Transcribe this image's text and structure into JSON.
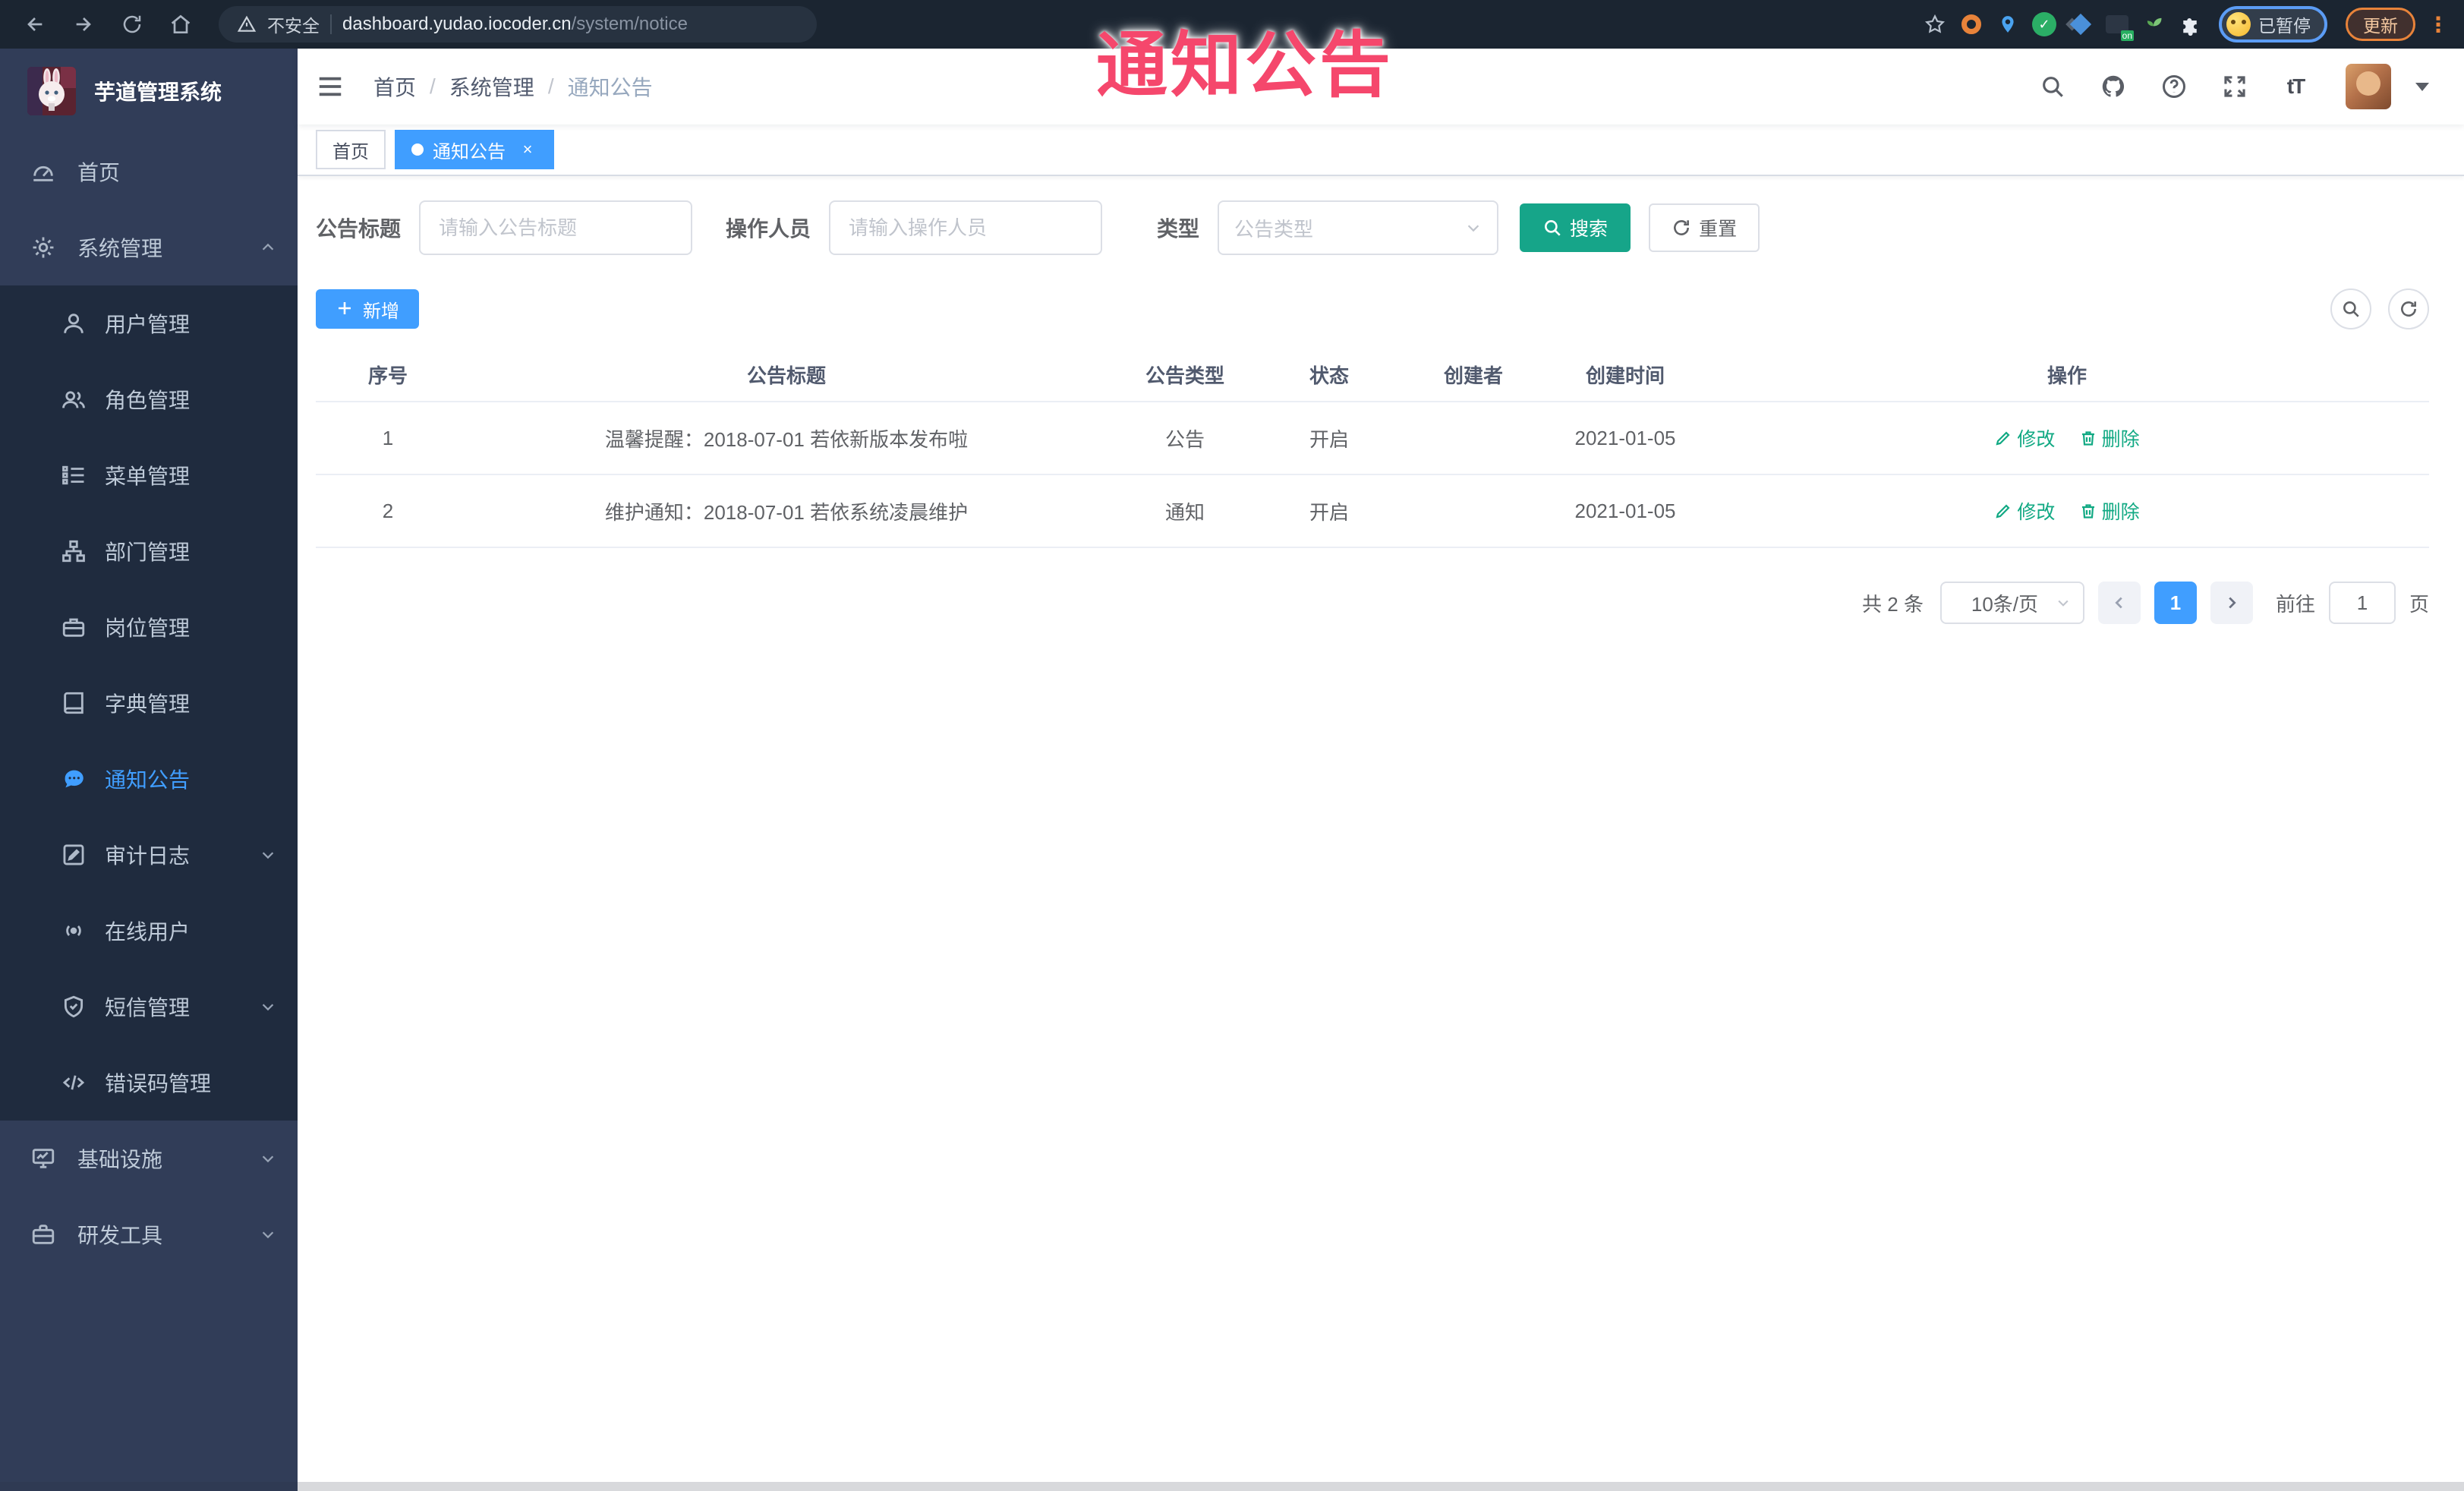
{
  "browser": {
    "security_label": "不安全",
    "url_domain": "dashboard.yudao.iocoder.cn",
    "url_path": "/system/notice",
    "profile_status": "已暂停",
    "update_label": "更新"
  },
  "watermark_text": "通知公告",
  "sidebar": {
    "title": "芋道管理系统",
    "items": [
      {
        "label": "首页",
        "icon": "dashboard-icon"
      },
      {
        "label": "系统管理",
        "icon": "gear-icon",
        "state": "expanded"
      },
      {
        "label": "用户管理",
        "icon": "user-icon"
      },
      {
        "label": "角色管理",
        "icon": "roles-icon"
      },
      {
        "label": "菜单管理",
        "icon": "menu-tree-icon"
      },
      {
        "label": "部门管理",
        "icon": "org-icon"
      },
      {
        "label": "岗位管理",
        "icon": "post-icon"
      },
      {
        "label": "字典管理",
        "icon": "dict-icon"
      },
      {
        "label": "通知公告",
        "icon": "notice-icon",
        "state": "active"
      },
      {
        "label": "审计日志",
        "icon": "audit-log-icon",
        "state": "collapsed"
      },
      {
        "label": "在线用户",
        "icon": "online-user-icon"
      },
      {
        "label": "短信管理",
        "icon": "sms-icon",
        "state": "collapsed"
      },
      {
        "label": "错误码管理",
        "icon": "error-code-icon"
      },
      {
        "label": "基础设施",
        "icon": "infrastructure-icon",
        "state": "collapsed"
      },
      {
        "label": "研发工具",
        "icon": "dev-tools-icon",
        "state": "collapsed"
      }
    ]
  },
  "breadcrumb": [
    "首页",
    "系统管理",
    "通知公告"
  ],
  "tabs": [
    {
      "label": "首页",
      "active": false
    },
    {
      "label": "通知公告",
      "active": true,
      "close": "×"
    }
  ],
  "filters": {
    "title_label": "公告标题",
    "title_placeholder": "请输入公告标题",
    "operator_label": "操作人员",
    "operator_placeholder": "请输入操作人员",
    "type_label": "类型",
    "type_placeholder": "公告类型",
    "search_label": "搜索",
    "reset_label": "重置"
  },
  "toolbar": {
    "add_label": "新增"
  },
  "table": {
    "headers": [
      "序号",
      "公告标题",
      "公告类型",
      "状态",
      "创建者",
      "创建时间",
      "操作"
    ],
    "actions": {
      "edit": "修改",
      "delete": "删除"
    },
    "rows": [
      {
        "num": "1",
        "title": "温馨提醒：2018-07-01 若依新版本发布啦",
        "type": "公告",
        "status": "开启",
        "creator": "",
        "created_at": "2021-01-05"
      },
      {
        "num": "2",
        "title": "维护通知：2018-07-01 若依系统凌晨维护",
        "type": "通知",
        "status": "开启",
        "creator": "",
        "created_at": "2021-01-05"
      }
    ]
  },
  "pagination": {
    "total": "共 2 条",
    "page_size": "10条/页",
    "current_page": "1",
    "goto_label": "前往",
    "goto_value": "1",
    "unit_label": "页"
  },
  "colors": {
    "primary": "#409EFF",
    "search_teal": "#16A589",
    "action_link": "#11A983",
    "watermark_pink": "#F5476C",
    "sidebar_bg": "#313D58",
    "submenu_bg": "#1F2B3E",
    "chrome_bg": "#1B2531"
  }
}
